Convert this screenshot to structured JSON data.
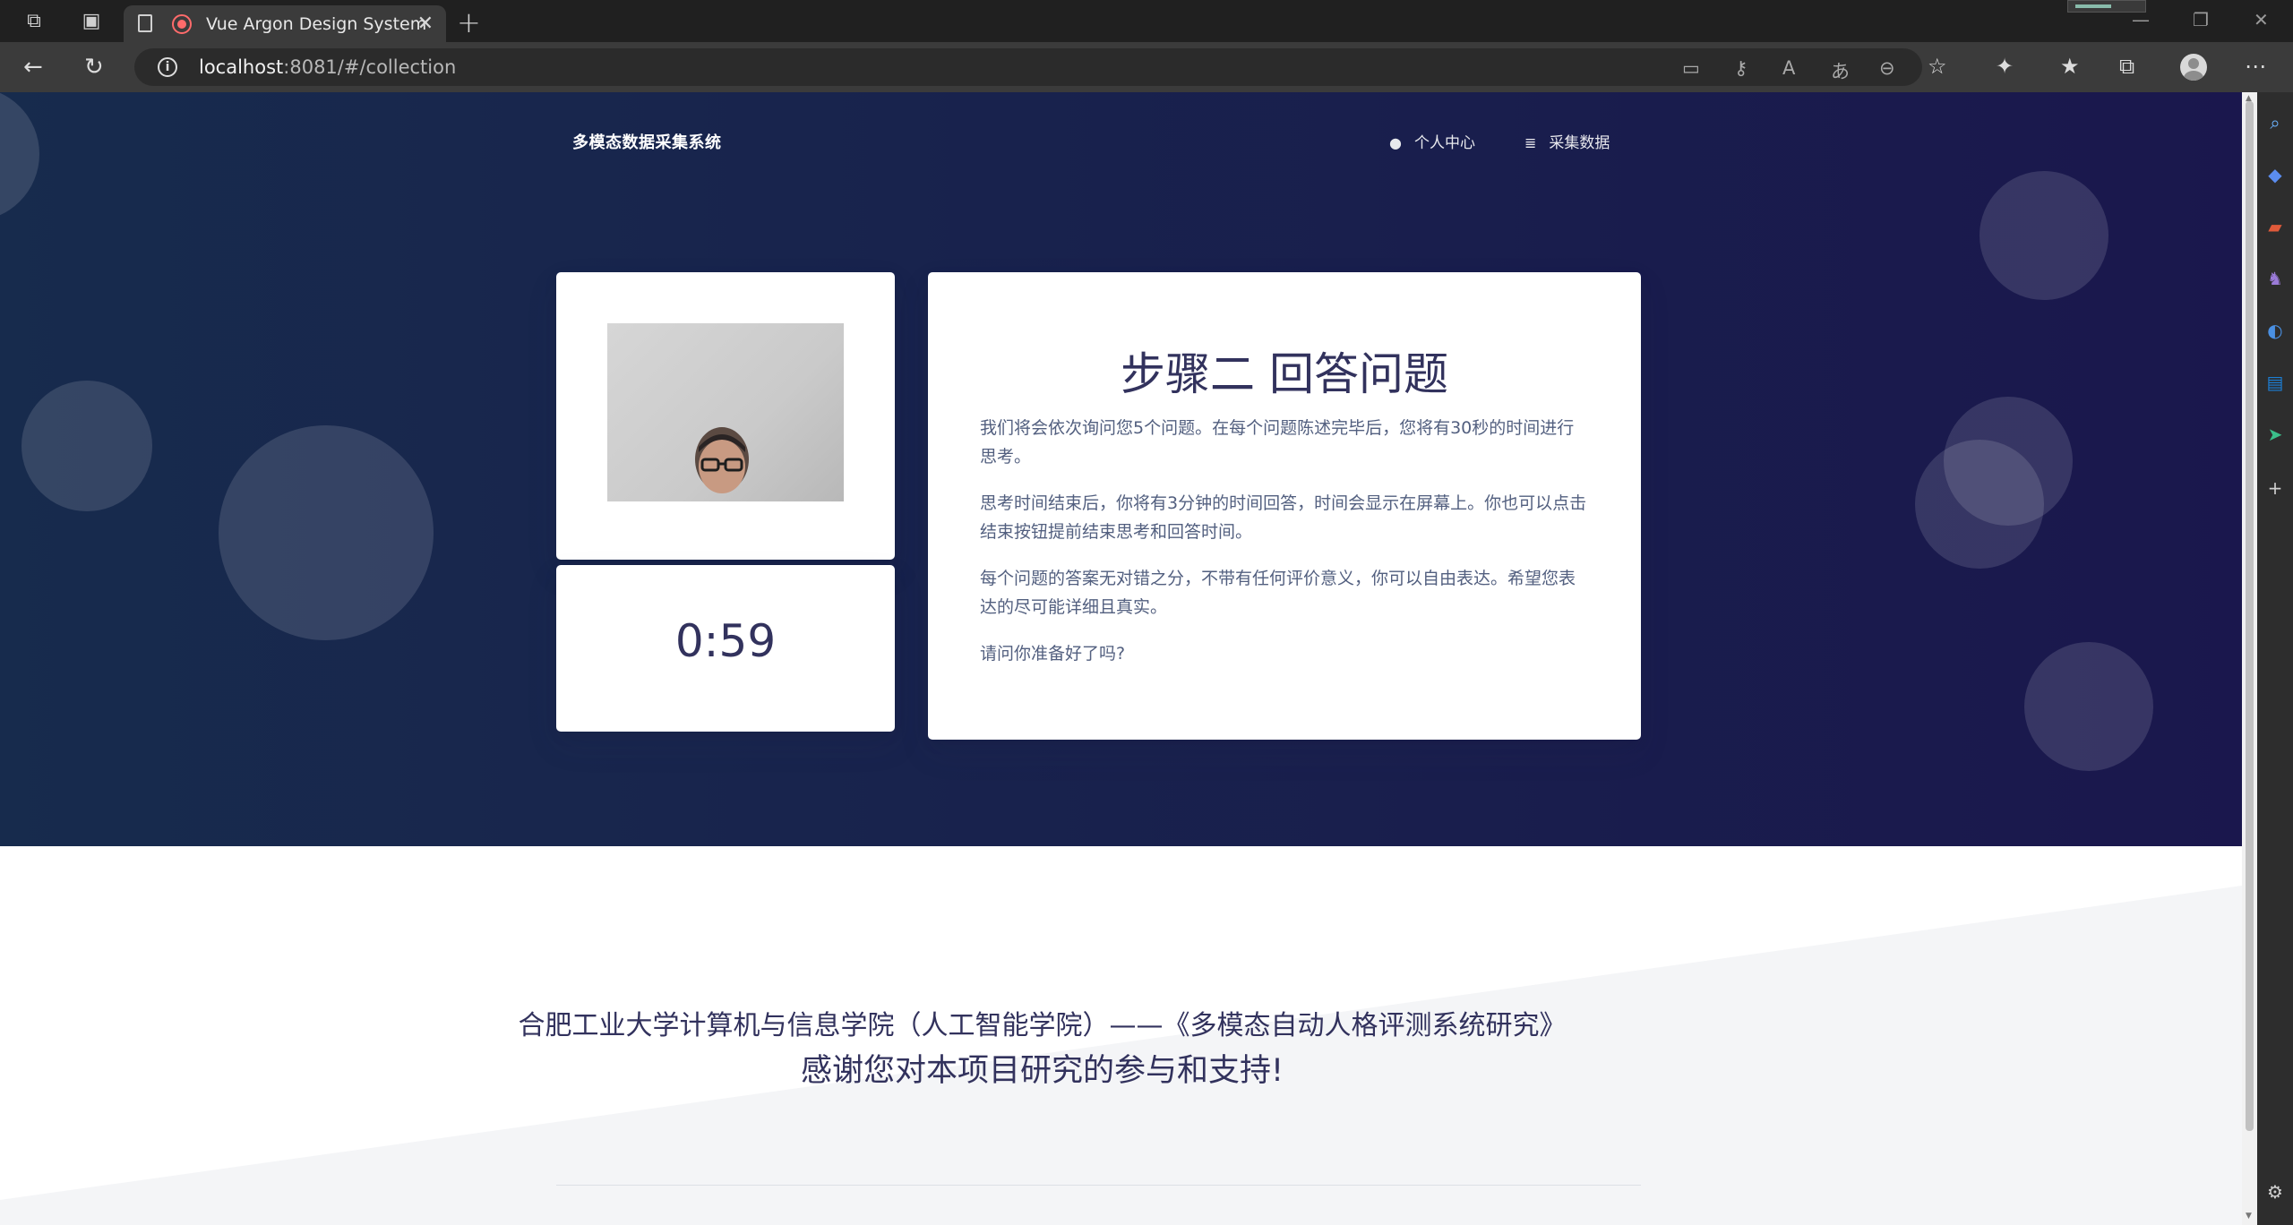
{
  "browser": {
    "tab_title": "Vue Argon Design System",
    "url_host": "localhost",
    "url_rest": ":8081/#/collection"
  },
  "navbar": {
    "brand": "多模态数据采集系统",
    "links": [
      "个人中心",
      "采集数据"
    ]
  },
  "timer": "0:59",
  "question": {
    "title": "步骤二 回答问题",
    "paragraphs": [
      "我们将会依次询问您5个问题。在每个问题陈述完毕后，您将有30秒的时间进行思考。",
      "思考时间结束后，你将有3分钟的时间回答，时间会显示在屏幕上。你也可以点击结束按钮提前结束思考和回答时间。",
      "每个问题的答案无对错之分，不带有任何评价意义，你可以自由表达。希望您表达的尽可能详细且真实。",
      "请问你准备好了吗?"
    ]
  },
  "footer": {
    "credit": "合肥工业大学计算机与信息学院（人工智能学院）——《多模态自动人格评测系统研究》",
    "thanks": "感谢您对本项目研究的参与和支持!"
  },
  "colors": {
    "hero_start": "#172b4d",
    "hero_end": "#1a174d",
    "heading": "#32325d",
    "body_text": "#525f7f"
  }
}
